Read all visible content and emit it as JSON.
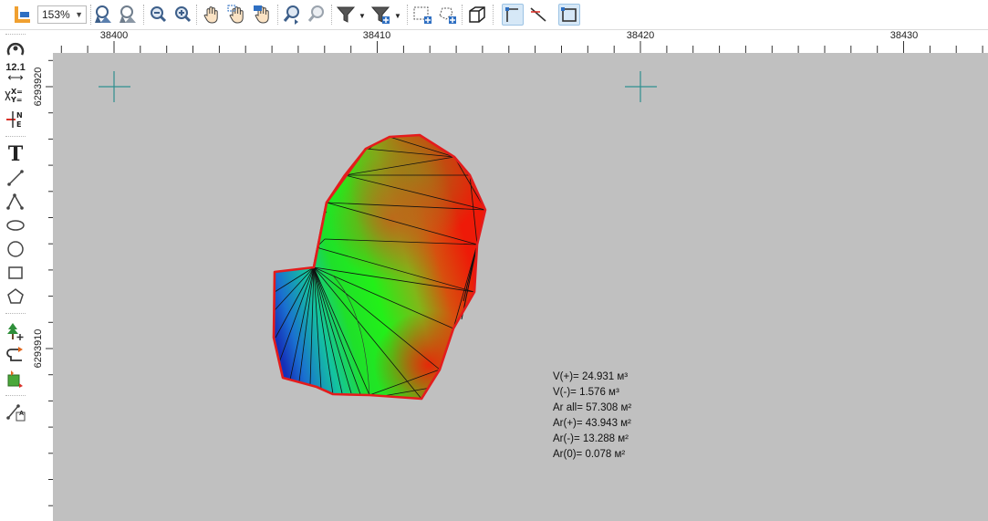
{
  "toolbar": {
    "zoom_value": "153%",
    "buttons": [
      {
        "name": "layer-properties-button",
        "icon": "ruler-frame-icon",
        "active": false
      },
      {
        "name": "zoom-extents-button",
        "icon": "magnifier-mountain-icon"
      },
      {
        "name": "zoom-window-button",
        "icon": "magnifier-mountain-gray-icon"
      },
      {
        "name": "zoom-out-button",
        "icon": "zoom-out-icon"
      },
      {
        "name": "zoom-in-button",
        "icon": "zoom-in-icon"
      },
      {
        "name": "pan-button",
        "icon": "hand-icon"
      },
      {
        "name": "pan-select-button",
        "icon": "hand-select-icon"
      },
      {
        "name": "pan-north-button",
        "icon": "hand-north-icon"
      },
      {
        "name": "zoom-previous-button",
        "icon": "magnifier-back-icon"
      },
      {
        "name": "zoom-next-button",
        "icon": "magnifier-forward-icon"
      },
      {
        "name": "filter-button",
        "icon": "funnel-icon"
      },
      {
        "name": "filter-add-button",
        "icon": "funnel-plus-icon"
      },
      {
        "name": "select-rect-button",
        "icon": "dashed-rect-add-icon"
      },
      {
        "name": "select-lasso-button",
        "icon": "dashed-lasso-add-icon"
      },
      {
        "name": "3d-view-button",
        "icon": "cube-icon"
      },
      {
        "name": "snap-corner-button",
        "icon": "corner-snap-icon",
        "active": true
      },
      {
        "name": "snap-line-button",
        "icon": "line-snap-icon"
      },
      {
        "name": "snap-frame-button",
        "icon": "frame-snap-icon",
        "active": true
      }
    ]
  },
  "leftbar": {
    "tools": [
      {
        "name": "measure-tool",
        "icon": "arc-measure-icon"
      },
      {
        "name": "distance-tool",
        "icon": "distance-label-icon",
        "label": "12.1"
      },
      {
        "name": "coordinates-tool",
        "icon": "xy-coordinates-icon",
        "label": "X=\nY="
      },
      {
        "name": "ne-tool",
        "icon": "north-east-icon",
        "label": "N\nE"
      },
      {
        "name": "text-tool",
        "icon": "text-T-icon",
        "label": "T"
      },
      {
        "name": "line-tool",
        "icon": "line-icon"
      },
      {
        "name": "polyline-tool",
        "icon": "polyline-icon"
      },
      {
        "name": "ellipse-tool",
        "icon": "ellipse-icon"
      },
      {
        "name": "circle-tool",
        "icon": "circle-icon"
      },
      {
        "name": "rectangle-tool",
        "icon": "rectangle-icon"
      },
      {
        "name": "polygon-tool",
        "icon": "pentagon-icon"
      },
      {
        "name": "add-point-tool",
        "icon": "tree-plus-icon"
      },
      {
        "name": "edit-contour-tool",
        "icon": "contour-edit-icon"
      },
      {
        "name": "fill-tool",
        "icon": "fill-square-icon"
      },
      {
        "name": "label-line-tool",
        "icon": "line-label-icon",
        "label": "A"
      }
    ]
  },
  "map": {
    "x_ticks": [
      "38400",
      "38410",
      "38420",
      "38430"
    ],
    "y_ticks": [
      "6293920",
      "6293910"
    ],
    "background": "#c0c0c0",
    "boundary_color": "#e41c1c",
    "grid_cross_color": "#2f8f8f"
  },
  "stats": [
    "V(+)= 24.931 м³",
    "V(-)= 1.576 м³",
    "Ar all= 57.308 м²",
    "Ar(+)= 43.943 м²",
    "Ar(-)= 13.288 м²",
    "Ar(0)= 0.078 м²"
  ]
}
